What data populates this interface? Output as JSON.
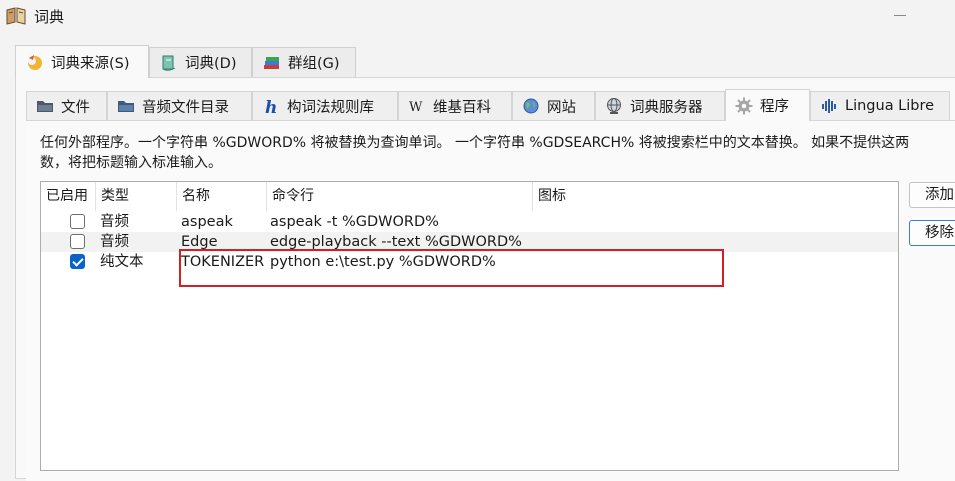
{
  "window": {
    "title": "词典"
  },
  "outer_tabs": [
    {
      "label": "词典来源(S)",
      "icon": "sources-icon",
      "active": true
    },
    {
      "label": "词典(D)",
      "icon": "dictionary-book-icon",
      "active": false
    },
    {
      "label": "群组(G)",
      "icon": "books-stack-icon",
      "active": false
    }
  ],
  "inner_tabs": [
    {
      "label": "文件",
      "icon": "folder-icon"
    },
    {
      "label": "音频文件目录",
      "icon": "audio-folder-icon"
    },
    {
      "label": "构词法规则库",
      "icon": "hunspell-h-icon"
    },
    {
      "label": "维基百科",
      "icon": "wikipedia-w-icon"
    },
    {
      "label": "网站",
      "icon": "globe-icon"
    },
    {
      "label": "词典服务器",
      "icon": "server-globe-icon"
    },
    {
      "label": "程序",
      "icon": "gear-icon",
      "active": true
    },
    {
      "label": "Lingua Libre",
      "icon": "lingua-libre-icon"
    }
  ],
  "description": {
    "line1": "任何外部程序。一个字符串 %GDWORD% 将被替换为查询单词。 一个字符串 %GDSEARCH% 将被搜索栏中的文本替换。 如果不提供这两",
    "line2": "数，将把标题输入标准输入。"
  },
  "table": {
    "columns": [
      "已启用",
      "类型",
      "名称",
      "命令行",
      "图标"
    ],
    "rows": [
      {
        "enabled": false,
        "type": "音频",
        "name": "aspeak",
        "command": "aspeak -t %GDWORD%",
        "icon": ""
      },
      {
        "enabled": false,
        "type": "音频",
        "name": "Edge",
        "command": "edge-playback --text  %GDWORD%",
        "icon": ""
      },
      {
        "enabled": true,
        "type": "纯文本",
        "name": "TOKENIZER",
        "command": "python e:\\test.py %GDWORD%",
        "icon": ""
      }
    ]
  },
  "buttons": {
    "add": "添加",
    "remove": "移除"
  },
  "colors": {
    "highlight": "#d41f24",
    "checkbox_checked": "#0a64c8"
  }
}
